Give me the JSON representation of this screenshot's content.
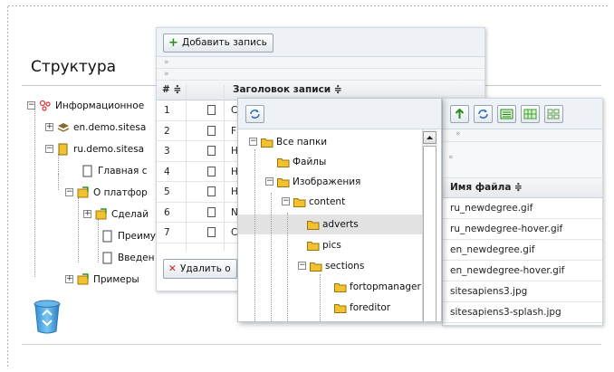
{
  "structure": {
    "title": "Структура",
    "tree": [
      {
        "label": "Информационное",
        "expander": "−"
      },
      {
        "label": "en.demo.sitesa",
        "expander": "+"
      },
      {
        "label": "ru.demo.sitesa",
        "expander": "−"
      },
      {
        "label": "Главная с"
      },
      {
        "label": "О платфор",
        "expander": "−"
      },
      {
        "label": "Сделай",
        "expander": "+"
      },
      {
        "label": "Преиму"
      },
      {
        "label": "Введен"
      },
      {
        "label": "Примеры",
        "expander": "+"
      }
    ],
    "trash_icon": "recycle-bin-icon"
  },
  "records": {
    "add_label": "Добавить запись",
    "pager": [
      "»",
      "»"
    ],
    "col_num": "# ≑",
    "col_title": "Заголовок записи ≑",
    "rows": [
      {
        "num": "1",
        "title": "С"
      },
      {
        "num": "2",
        "title": "F"
      },
      {
        "num": "3",
        "title": "Н"
      },
      {
        "num": "4",
        "title": "Н"
      },
      {
        "num": "5",
        "title": "Н"
      },
      {
        "num": "6",
        "title": "N"
      },
      {
        "num": "7",
        "title": "С"
      }
    ],
    "delete_label": "Удалить о"
  },
  "folders": {
    "refresh_icon": "refresh-icon",
    "items": [
      {
        "label": "Все папки",
        "expander": "−"
      },
      {
        "label": "Файлы"
      },
      {
        "label": "Изображения",
        "expander": "−"
      },
      {
        "label": "content",
        "expander": "−"
      },
      {
        "label": "adverts",
        "selected": true
      },
      {
        "label": "pics"
      },
      {
        "label": "sections",
        "expander": "−"
      },
      {
        "label": "fortopmanager"
      },
      {
        "label": "foreditor"
      }
    ]
  },
  "files": {
    "pager_top": "»",
    "pager_side": "«",
    "col_name": "Имя файла ≑",
    "rows": [
      "ru_newdegree.gif",
      "ru_newdegree-hover.gif",
      "en_newdegree.gif",
      "en_newdegree-hover.gif",
      "sitesapiens3.jpg",
      "sitesapiens3-splash.jpg"
    ]
  },
  "colors": {
    "accent_green": "#2a8a1a",
    "delete_red": "#cc1a1a",
    "folder_yellow": "#f2c12e",
    "panel_border": "#cfd7e0"
  }
}
